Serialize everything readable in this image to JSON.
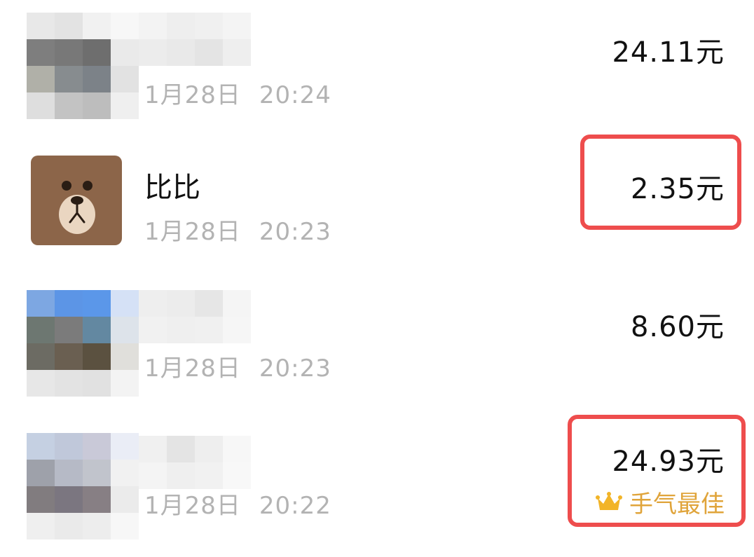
{
  "colors": {
    "amount_text": "#111111",
    "time_text": "#b3b3b3",
    "best_luck_text": "#e0a43a",
    "highlight_border": "#ee4d4d",
    "bear_fur": "#8c6549"
  },
  "records": [
    {
      "name": "",
      "avatar": "pixelated-avatar",
      "date": "1月28日",
      "time": "20:24",
      "amount": "24.11元",
      "highlighted": false
    },
    {
      "name": "比比",
      "avatar": "brown-bear-avatar",
      "date": "1月28日",
      "time": "20:23",
      "amount": "2.35元",
      "highlighted": true
    },
    {
      "name": "",
      "avatar": "pixelated-avatar",
      "date": "1月28日",
      "time": "20:23",
      "amount": "8.60元",
      "highlighted": false
    },
    {
      "name": "",
      "avatar": "pixelated-avatar",
      "date": "1月28日",
      "time": "20:22",
      "amount": "24.93元",
      "highlighted": true,
      "best_luck_label": "手气最佳",
      "best_luck_icon": "crown-icon"
    }
  ]
}
